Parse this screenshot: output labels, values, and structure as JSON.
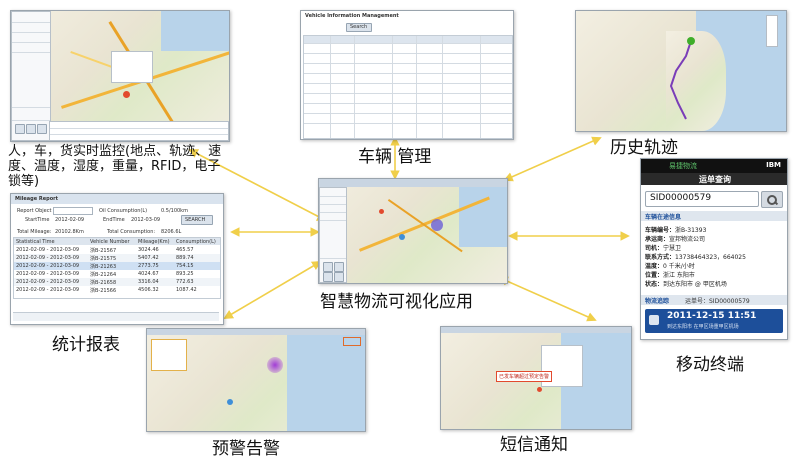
{
  "labels": {
    "monitor": "人，车，货实时监控(地点、轨迹、速度、温度，湿度，重量，RFID，电子锁等)",
    "monitor_line1": "人，车，货实时监控(地点、轨迹、速",
    "monitor_line2": "度、温度，湿度，重量，RFID，电子",
    "monitor_line3": "锁等)",
    "vehicle_mgmt": "车辆 管理",
    "history_track": "历史轨迹",
    "stats_report": "统计报表",
    "center_app": "智慧物流可视化应用",
    "mobile": "移动终端",
    "warning": "预警告警",
    "sms": "短信通知"
  },
  "vehicle_screen": {
    "title": "Vehicle Information Management",
    "search_button": "Search"
  },
  "report_screen": {
    "title": "Mileage Report",
    "report_object_label": "Report Object",
    "fuel_label": "Oil Consumption(L)",
    "fuel_value": "0.5/100km",
    "start_time_label": "StartTime",
    "start_time": "2012-02-09",
    "end_time_label": "EndTime",
    "end_time": "2012-03-09",
    "search_button": "SEARCH",
    "total_mileage_label": "Total Mileage:",
    "total_mileage": "20102.8Km",
    "total_consumption_label": "Total Consumption:",
    "total_consumption": "8206.6L",
    "columns": [
      "Statistical Time",
      "Vehicle Number",
      "Mileage(Km)",
      "Consumption(L)"
    ],
    "rows": [
      [
        "2012-02-09 - 2012-03-09",
        "浙B-21567",
        "3024.46",
        "465.57"
      ],
      [
        "2012-02-09 - 2012-03-09",
        "浙B-21575",
        "5407.42",
        "889.74"
      ],
      [
        "2012-02-09 - 2012-03-09",
        "浙B-21263",
        "2773.75",
        "754.15"
      ],
      [
        "2012-02-09 - 2012-03-09",
        "浙B-21264",
        "4024.67",
        "893.25"
      ],
      [
        "2012-02-09 - 2012-03-09",
        "浙B-21658",
        "3316.04",
        "772.63"
      ],
      [
        "2012-02-09 - 2012-03-09",
        "浙B-21566",
        "4506.32",
        "1087.42"
      ]
    ]
  },
  "mobile_screen": {
    "brand": "易捷物流",
    "ibm": "IBM",
    "header": "运单查询",
    "search_value": "SID00000579",
    "section_title": "车辆在途信息",
    "fields": [
      {
        "label": "车辆编号：",
        "value": "浙B-31393"
      },
      {
        "label": "承运商：",
        "value": "宣邦物流公司"
      },
      {
        "label": "司机：",
        "value": "宁慧卫"
      },
      {
        "label": "联系方式：",
        "value": "13738464323，664025"
      },
      {
        "label": "温度：",
        "value": "0 千米/小时"
      },
      {
        "label": "位置：",
        "value": "浙江 东阳市"
      },
      {
        "label": "状态：",
        "value": "到达东阳市 @ 甲区机场"
      }
    ],
    "tracking_label": "物流追踪",
    "order_label": "运单号：SID00000579",
    "event_time": "2011-12-15 11:51",
    "event_desc": "到达东阳市 在甲区场重甲区机场"
  },
  "sms_screen": {
    "popup_text": "已发车辆超过预定告警"
  },
  "colors": {
    "arrow": "#f0cf4a",
    "mobile_header": "#111111",
    "mobile_blue": "#1d4f9a"
  },
  "icons": [
    "search-icon",
    "arrow-icon",
    "map-marker-icon",
    "map-icon"
  ]
}
